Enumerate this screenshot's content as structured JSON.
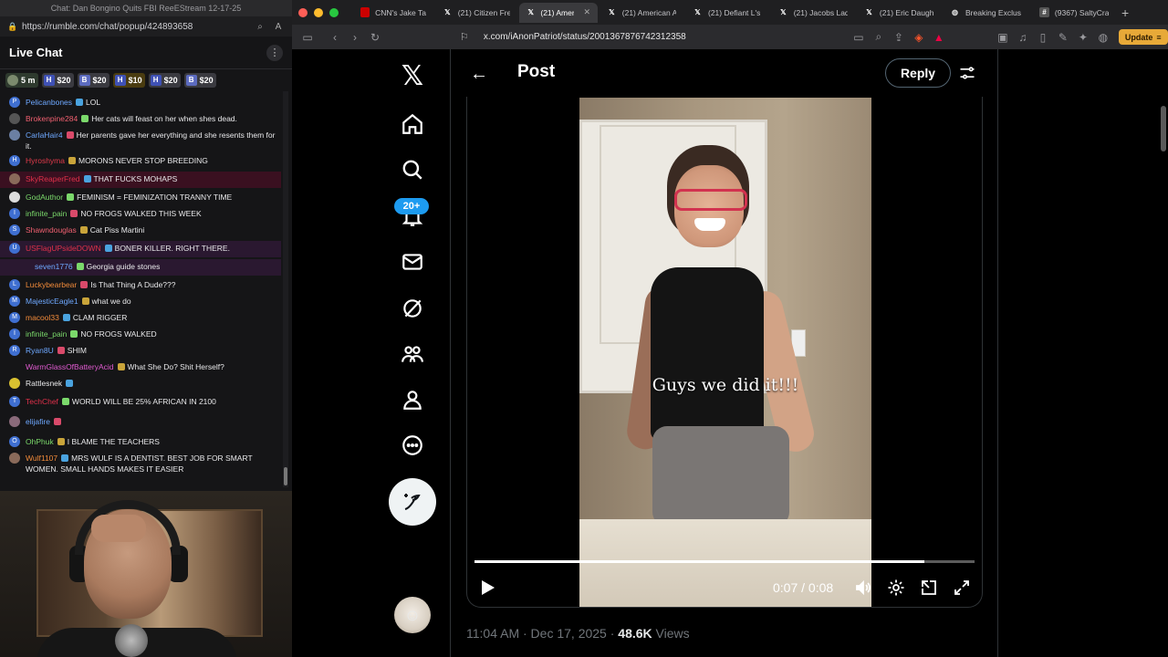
{
  "chat_window": {
    "title": "Chat: Dan Bongino Quits FBI ReeEStream 12-17-25",
    "url": "https://rumble.com/chat/popup/424893658",
    "header": "Live Chat",
    "rants": [
      {
        "label": "5 m",
        "icon": "tip-icon"
      },
      {
        "label": "$20",
        "letter": "H"
      },
      {
        "label": "$20",
        "letter": "B"
      },
      {
        "label": "$10",
        "letter": "H"
      },
      {
        "label": "$20",
        "letter": "H"
      },
      {
        "label": "$20",
        "letter": "B"
      }
    ],
    "messages": [
      {
        "user": "Pelicanbones",
        "text": "LOL",
        "user_color": "#6ea8ff",
        "avatar": "P",
        "avatar_color": "#3f6fd1"
      },
      {
        "user": "Brokenpine284",
        "text": "Her cats will feast on her when shes dead.",
        "user_color": "#f06070",
        "avatar": "",
        "avatar_color": "#555"
      },
      {
        "user": "CarlaHair4",
        "text": "Her parents gave her everything and she resents them for it.",
        "user_color": "#6ea8ff",
        "avatar": "",
        "avatar_color": "#6b7fa3"
      },
      {
        "user": "Hyroshyma",
        "text": "MORONS NEVER STOP BREEDING",
        "user_color": "#e03a4a",
        "avatar": "H",
        "avatar_color": "#3f6fd1"
      },
      {
        "user": "SkyReaperFred",
        "text": "THAT FUCKS MOHAPS",
        "user_color": "#e0304a",
        "avatar": "",
        "avatar_color": "#8a6a5a"
      },
      {
        "user": "GodAuthor",
        "text": "FEMINISM = FEMINIZATION TRANNY TIME",
        "user_color": "#7bd96b",
        "avatar": "",
        "avatar_color": "#ddd"
      },
      {
        "user": "infinite_pain",
        "text": "NO FROGS WALKED THIS WEEK",
        "user_color": "#7bd96b",
        "avatar": "I",
        "avatar_color": "#3f6fd1"
      },
      {
        "user": "Shawndouglas",
        "text": "Cat Piss Martini",
        "user_color": "#f06070",
        "avatar": "S",
        "avatar_color": "#3f6fd1"
      },
      {
        "user": "USFlagUPsideDOWN",
        "text": "BONER KILLER. RIGHT THERE.",
        "user_color": "#e0304a",
        "avatar": "U",
        "avatar_color": "#3f6fd1"
      },
      {
        "user": "seven1776",
        "text": "Georgia guide stones",
        "user_color": "#6ea8ff",
        "avatar": "",
        "avatar_color": "transparent"
      },
      {
        "user": "Luckybearbear",
        "text": "Is That Thing A Dude???",
        "user_color": "#f08a3a",
        "avatar": "L",
        "avatar_color": "#3f6fd1"
      },
      {
        "user": "MajesticEagle1",
        "text": "what we do",
        "user_color": "#6ea8ff",
        "avatar": "M",
        "avatar_color": "#3f6fd1"
      },
      {
        "user": "macool33",
        "text": "CLAM RIGGER",
        "user_color": "#f08a3a",
        "avatar": "M",
        "avatar_color": "#3f6fd1"
      },
      {
        "user": "infinite_pain",
        "text": "NO FROGS WALKED",
        "user_color": "#7bd96b",
        "avatar": "I",
        "avatar_color": "#3f6fd1"
      },
      {
        "user": "Ryan8U",
        "text": "SHIM",
        "user_color": "#6ea8ff",
        "avatar": "R",
        "avatar_color": "#3f6fd1"
      },
      {
        "user": "WarmGlassOfBatteryAcid",
        "text": "What She Do? Shit Herself?",
        "user_color": "#e05ad0",
        "avatar": "",
        "avatar_color": "transparent"
      },
      {
        "user": "Rattlesnek",
        "text": "",
        "user_color": "#e8e8ea",
        "avatar": "",
        "avatar_color": "#d8c030"
      },
      {
        "user": "TechChef",
        "text": "WORLD WILL BE 25% AFRICAN IN 2100",
        "user_color": "#e0304a",
        "avatar": "T",
        "avatar_color": "#3f6fd1"
      },
      {
        "user": "elijafire",
        "text": "",
        "user_color": "#6ea8ff",
        "avatar": "",
        "avatar_color": "#8a6a7a"
      },
      {
        "user": "OhPhuk",
        "text": "I BLAME THE TEACHERS",
        "user_color": "#7bd96b",
        "avatar": "O",
        "avatar_color": "#3f6fd1"
      },
      {
        "user": "Wulf1107",
        "text": "MRS WULF IS A DENTIST. BEST JOB FOR SMART WOMEN. SMALL HANDS MAKES IT EASIER",
        "user_color": "#f08a3a",
        "avatar": "",
        "avatar_color": "#8a6a5a"
      }
    ]
  },
  "browser": {
    "tabs": [
      {
        "label": "CNN's Jake Tap",
        "favicon": "CNN"
      },
      {
        "label": "(21) Citizen Fre",
        "favicon": "X"
      },
      {
        "label": "(21) Americ",
        "favicon": "X",
        "active": true
      },
      {
        "label": "(21) American A",
        "favicon": "X"
      },
      {
        "label": "(21) Defiant L's",
        "favicon": "X"
      },
      {
        "label": "(21) Jacobs Lad",
        "favicon": "X"
      },
      {
        "label": "(21) Eric Daugh",
        "favicon": "X"
      },
      {
        "label": "Breaking Exclus",
        "favicon": "globe"
      },
      {
        "label": "(9367) SaltyCra",
        "favicon": "#"
      }
    ],
    "url": "x.com/iAnonPatriot/status/2001367876742312358",
    "update_label": "Update",
    "shield_badge": "1"
  },
  "x": {
    "notifications_count": "20+",
    "header_title": "Post",
    "reply_label": "Reply",
    "video": {
      "caption": "Guys we did it!!!",
      "time": "0:07 / 0:08",
      "progress": 0.9
    },
    "post_time": "11:04 AM · Dec 17, 2025 · ",
    "views_count": "48.6K",
    "views_label": " Views"
  }
}
